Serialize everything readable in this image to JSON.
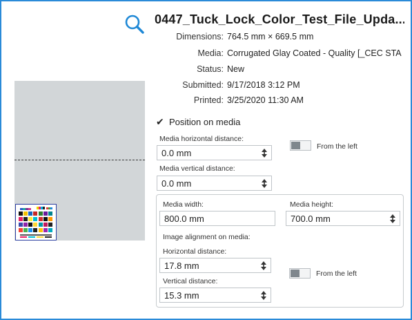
{
  "job": {
    "title": "0447_Tuck_Lock_Color_Test_File_Upda...",
    "details": [
      {
        "label": "Dimensions:",
        "value": "764.5 mm × 669.5 mm"
      },
      {
        "label": "Media:",
        "value": "Corrugated Glay Coated - Quality [_CEC STA"
      },
      {
        "label": "Status:",
        "value": "New"
      },
      {
        "label": "Submitted:",
        "value": "9/17/2018 3:12 PM"
      },
      {
        "label": "Printed:",
        "value": "3/25/2020 11:30 AM"
      }
    ]
  },
  "icons": {
    "search": "search-icon",
    "checkbox": "checkmark-icon",
    "stepper": "stepper-arrows-icon"
  },
  "position": {
    "checkbox_label": "Position on media",
    "checked": true,
    "media_horizontal_label": "Media horizontal distance:",
    "media_horizontal_value": "0.0 mm",
    "from_left_label": "From the left",
    "media_vertical_label": "Media vertical distance:",
    "media_vertical_value": "0.0 mm"
  },
  "media": {
    "width_label": "Media width:",
    "width_value": "800.0 mm",
    "height_label": "Media height:",
    "height_value": "700.0 mm",
    "alignment_label": "Image alignment on media:",
    "horizontal_label": "Horizontal distance:",
    "horizontal_value": "17.8 mm",
    "from_left_label": "From the left",
    "vertical_label": "Vertical distance:",
    "vertical_value": "15.3 mm"
  },
  "colors": {
    "accent": "#2a8ad8",
    "preview_bg": "#d2d6d8",
    "toggle_knob": "#7f878d"
  }
}
